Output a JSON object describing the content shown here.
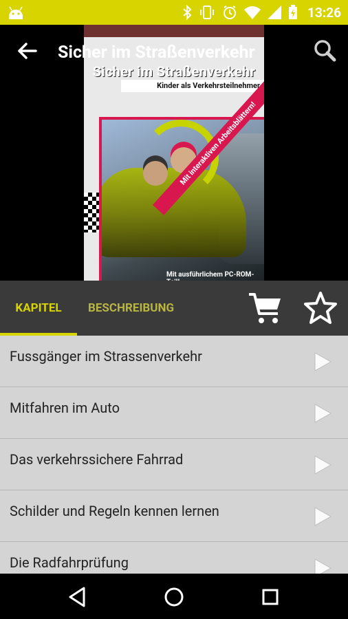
{
  "status_bar": {
    "time": "13:26",
    "icons": [
      "android-icon",
      "bluetooth-icon",
      "vibrate-icon",
      "alarm-icon",
      "wifi-icon",
      "signal-icon",
      "battery-icon"
    ]
  },
  "app_bar": {
    "title": "Sicher im Straßenverkehr",
    "back_icon": "back-arrow-icon",
    "search_icon": "search-icon"
  },
  "cover": {
    "headline": "Sicher im Straßenverkehr",
    "subtitle": "Kinder als Verkehrsteilnehmer",
    "sash": "Mit interaktiven Arbeitsblättern!",
    "footer": "Mit ausführlichem PC-ROM-Teil!"
  },
  "tabs": [
    {
      "label": "KAPITEL",
      "active": true
    },
    {
      "label": "BESCHREIBUNG",
      "active": false
    }
  ],
  "actions": {
    "cart_icon": "cart-icon",
    "favorite_icon": "star-outline-icon"
  },
  "chapters": [
    {
      "label": "Fussgänger im Strassenverkehr"
    },
    {
      "label": "Mitfahren im Auto"
    },
    {
      "label": "Das verkehrssichere Fahrrad"
    },
    {
      "label": "Schilder und Regeln kennen lernen"
    },
    {
      "label": "Die Radfahrprüfung"
    }
  ],
  "colors": {
    "accent": "#d8d400",
    "tab_bar": "#3a3a3a",
    "list_bg": "#d4d4d4"
  }
}
